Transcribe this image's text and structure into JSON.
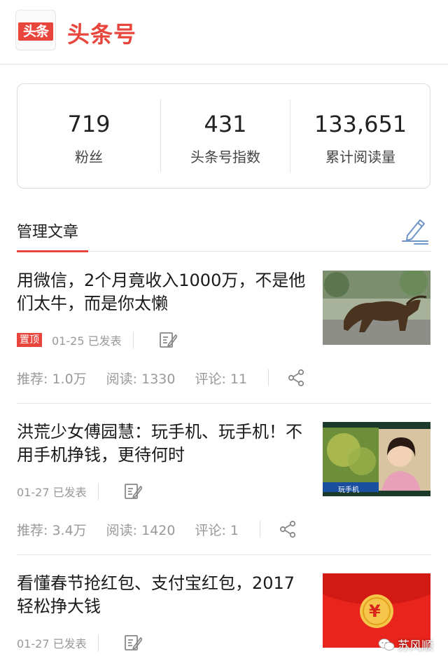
{
  "header": {
    "logo_text": "头条",
    "brand": "头条号"
  },
  "stats": [
    {
      "value": "719",
      "label": "粉丝"
    },
    {
      "value": "431",
      "label": "头条号指数"
    },
    {
      "value": "133,651",
      "label": "累计阅读量"
    }
  ],
  "section": {
    "title": "管理文章"
  },
  "articles": [
    {
      "title": "用微信，2个月竟收入1000万，不是他们太牛，而是你太懒",
      "tag": "置顶",
      "date": "01-25 已发表",
      "recommend": "推荐: 1.0万",
      "reads": "阅读: 1330",
      "comments": "评论: 11"
    },
    {
      "title": "洪荒少女傅园慧：玩手机、玩手机！不用手机挣钱，更待何时",
      "tag": "",
      "date": "01-27 已发表",
      "recommend": "推荐: 3.4万",
      "reads": "阅读: 1420",
      "comments": "评论: 1",
      "thumb_caption": "玩手机"
    },
    {
      "title": "看懂春节抢红包、支付宝红包，2017轻松挣大钱",
      "tag": "",
      "date": "01-27 已发表",
      "thumb_symbol": "¥"
    }
  ],
  "watermark": {
    "text": "苏风顺"
  },
  "colors": {
    "brand_red": "#e8453c",
    "text_gray": "#999999",
    "divider": "#e6e6e6",
    "icon_blue": "#6f94c9"
  },
  "icons": {
    "compose": "compose-icon",
    "edit": "edit-icon",
    "share": "share-icon",
    "wechat": "wechat-icon"
  }
}
